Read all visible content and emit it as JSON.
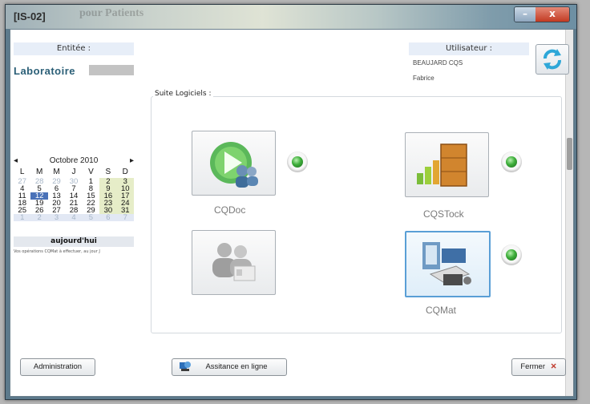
{
  "window": {
    "title": "[IS-02]",
    "ghost_text": "pour Patients",
    "minimize": "–",
    "close": "x"
  },
  "entity": {
    "label": "Entitée :",
    "value": "Laboratoire"
  },
  "user": {
    "label": "Utilisateur :",
    "name_line1": "BEAUJARD CQS",
    "name_line2": "Fabrice"
  },
  "calendar": {
    "month": "Octobre 2010",
    "prev": "◂",
    "next": "▸",
    "day_headers": [
      "L",
      "M",
      "M",
      "J",
      "V",
      "S",
      "D"
    ],
    "weeks": [
      [
        "27",
        "28",
        "29",
        "30",
        "1",
        "2",
        "3"
      ],
      [
        "4",
        "5",
        "6",
        "7",
        "8",
        "9",
        "10"
      ],
      [
        "11",
        "12",
        "13",
        "14",
        "15",
        "16",
        "17"
      ],
      [
        "18",
        "19",
        "20",
        "21",
        "22",
        "23",
        "24"
      ],
      [
        "25",
        "26",
        "27",
        "28",
        "29",
        "30",
        "31"
      ],
      [
        "1",
        "2",
        "3",
        "4",
        "5",
        "6",
        "7"
      ]
    ],
    "selected": "12",
    "today_label": "aujourd'hui",
    "note": "Vos opérations CQMat à effectuer, au jour J"
  },
  "suite": {
    "label": "Suite Logiciels :",
    "apps": [
      {
        "name": "CQDoc",
        "icon": "cqdoc-play-users-icon",
        "installed": true
      },
      {
        "name": "CQSTock",
        "icon": "cqstock-boxes-icon",
        "installed": true
      },
      {
        "name": "",
        "icon": "users-contacts-icon",
        "installed": false
      },
      {
        "name": "CQMat",
        "icon": "cqmat-equipment-icon",
        "installed": true
      }
    ]
  },
  "buttons": {
    "admin": "Administration",
    "assist": "Assitance en ligne",
    "close": "Fermer"
  },
  "colors": {
    "entity_text": "#2b5f77",
    "installed_indicator": "#3dae3a",
    "selected_day": "#4a72b8"
  }
}
